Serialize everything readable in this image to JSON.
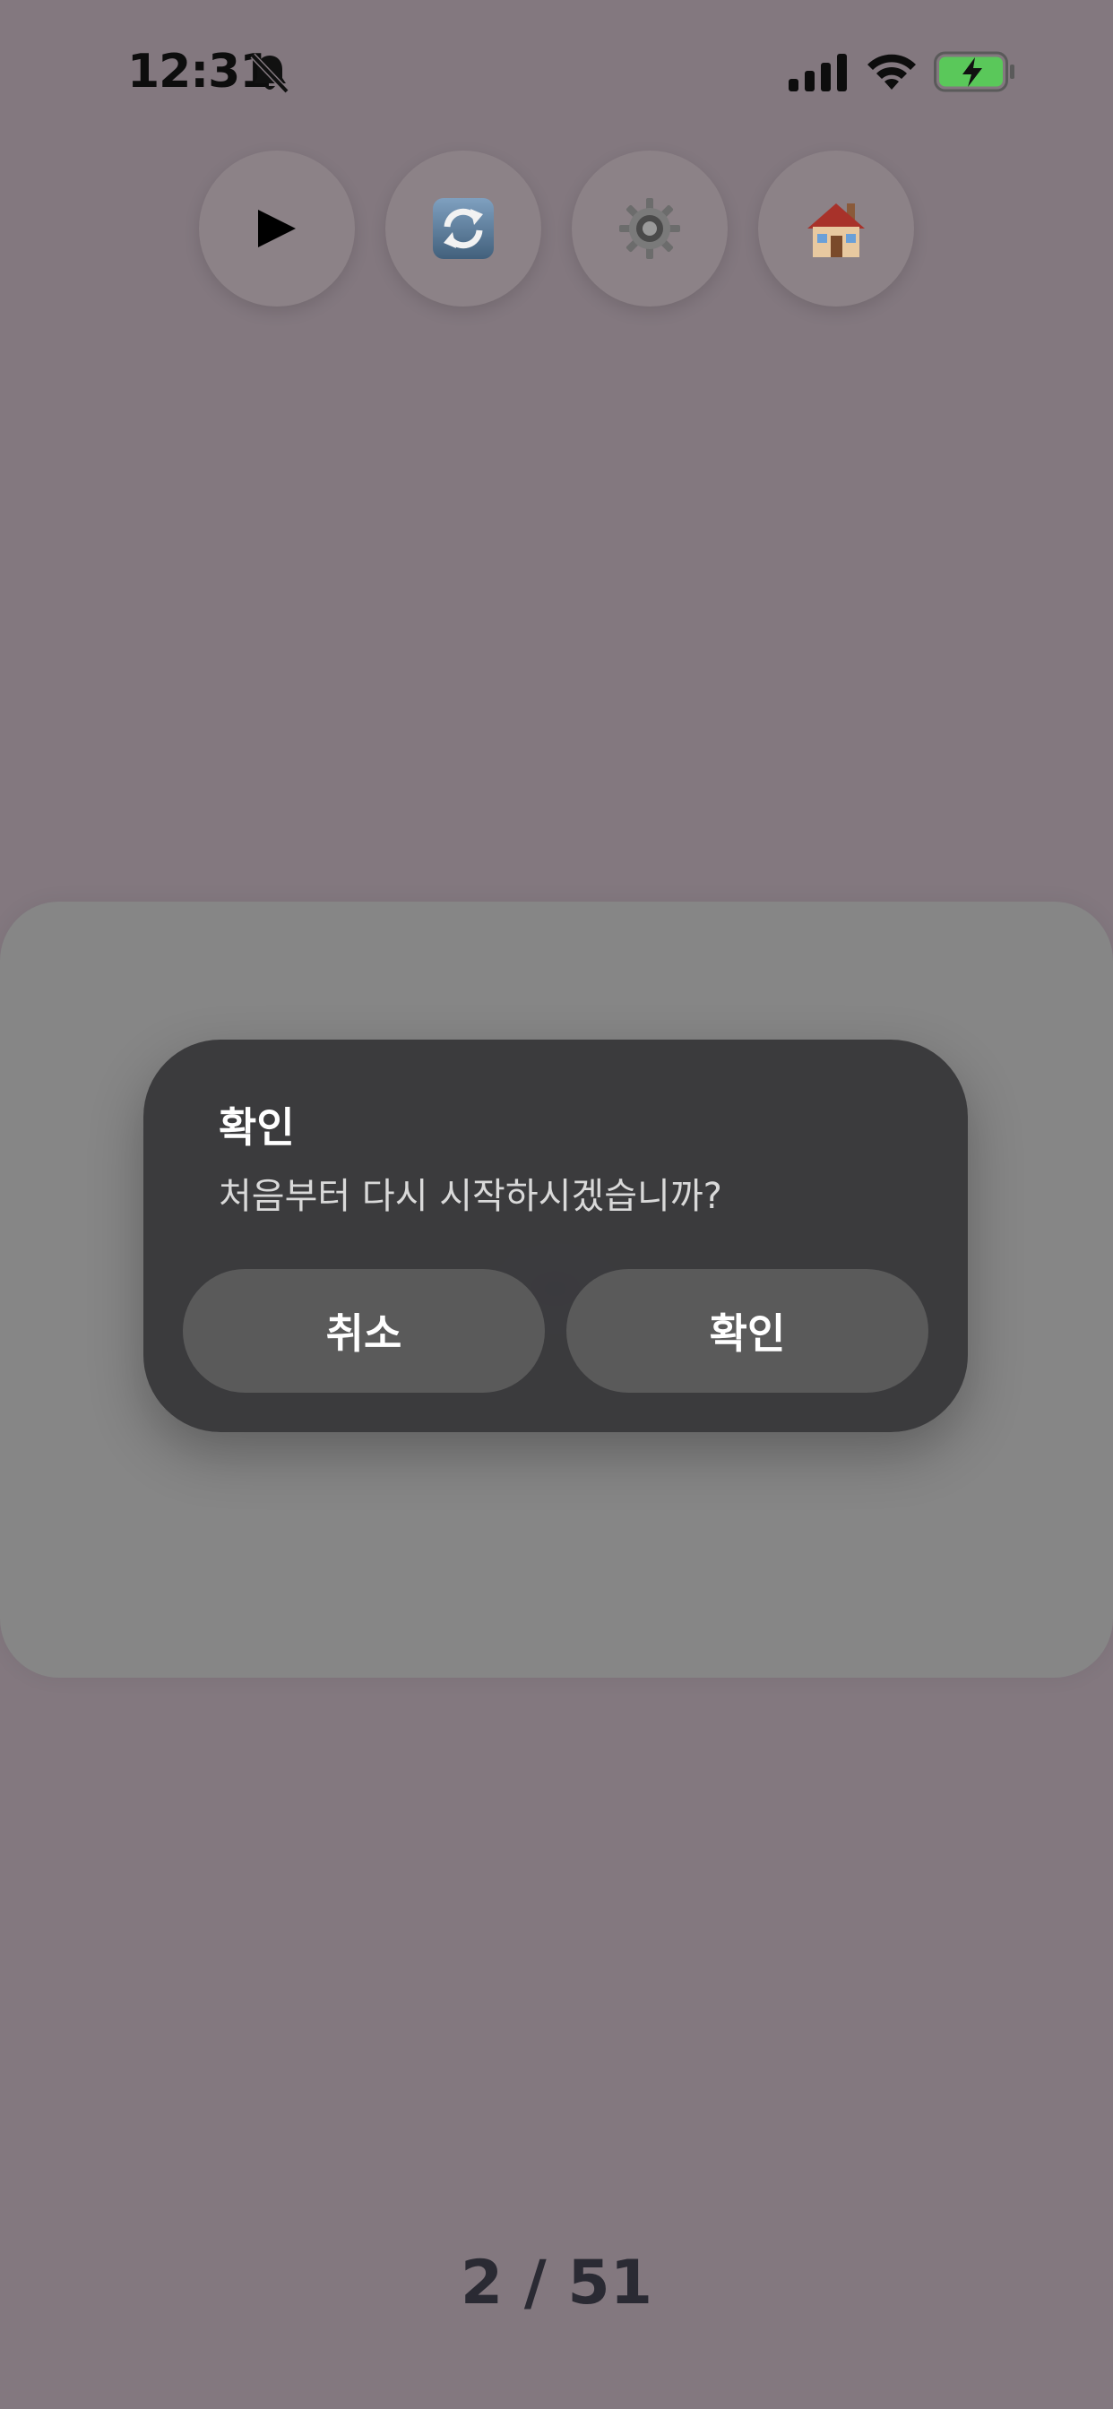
{
  "status_bar": {
    "time": "12:31",
    "icons": [
      "bell-slash-icon",
      "cellular-signal-icon",
      "wifi-icon",
      "battery-charging-icon"
    ],
    "battery_color": "#5ac85a"
  },
  "toolbar": {
    "buttons": [
      {
        "icon": "play-icon"
      },
      {
        "icon": "restart-icon"
      },
      {
        "icon": "gear-icon"
      },
      {
        "icon": "home-icon"
      }
    ]
  },
  "dialog": {
    "title": "확인",
    "message": "처음부터 다시 시작하시겠습니까?",
    "cancel_label": "취소",
    "confirm_label": "확인"
  },
  "pager": {
    "text": "2 / 51",
    "current": 2,
    "total": 51
  },
  "colors": {
    "background": "#83787f",
    "card": "#868686",
    "dialog": "#38383a",
    "dialog_button": "#5a5a5a"
  }
}
